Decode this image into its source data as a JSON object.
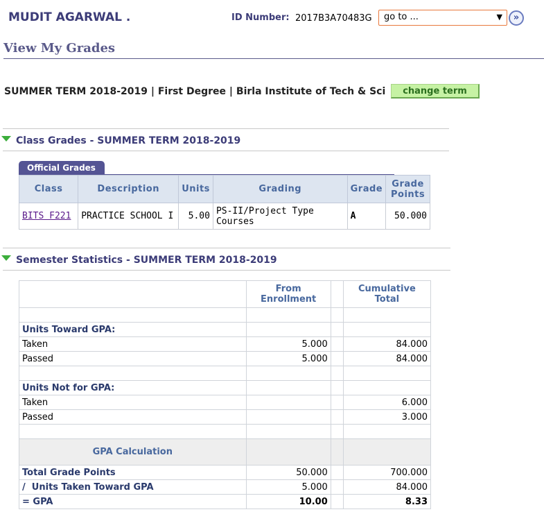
{
  "header": {
    "student_name": "MUDIT AGARWAL .",
    "id_label": "ID Number:",
    "id_value": "2017B3A70483G",
    "goto_select": "go to ...",
    "go_button": "»"
  },
  "page_title": "View My Grades",
  "term": {
    "line": "SUMMER TERM 2018-2019 | First Degree | Birla Institute of Tech & Sci",
    "change_term_button": "change term"
  },
  "class_grades": {
    "title": "Class Grades - SUMMER TERM 2018-2019",
    "tab_label": "Official Grades",
    "columns": [
      "Class",
      "Description",
      "Units",
      "Grading",
      "Grade",
      "Grade Points"
    ],
    "rows": [
      {
        "class": "BITS F221",
        "description": "PRACTICE SCHOOL I",
        "units": "5.00",
        "grading": "PS-II/Project Type Courses",
        "grade": "A",
        "grade_points": "50.000"
      }
    ]
  },
  "semester_stats": {
    "title": "Semester Statistics - SUMMER TERM 2018-2019",
    "col_from_enrollment": "From Enrollment",
    "col_cumulative": "Cumulative Total",
    "units_toward_gpa": {
      "heading": "Units Toward GPA:",
      "taken_label": "Taken",
      "taken_enroll": "5.000",
      "taken_cum": "84.000",
      "passed_label": "Passed",
      "passed_enroll": "5.000",
      "passed_cum": "84.000"
    },
    "units_not_gpa": {
      "heading": "Units Not for GPA:",
      "taken_label": "Taken",
      "taken_enroll": "",
      "taken_cum": "6.000",
      "passed_label": "Passed",
      "passed_enroll": "",
      "passed_cum": "3.000"
    },
    "gpa_calc_label": "GPA Calculation",
    "total_grade_points_label": "Total Grade Points",
    "total_grade_points_enroll": "50.000",
    "total_grade_points_cum": "700.000",
    "units_taken_label": "/  Units Taken Toward GPA",
    "units_taken_enroll": "5.000",
    "units_taken_cum": "84.000",
    "gpa_label": "= GPA",
    "gpa_enroll": "10.00",
    "gpa_cum": "8.33"
  }
}
